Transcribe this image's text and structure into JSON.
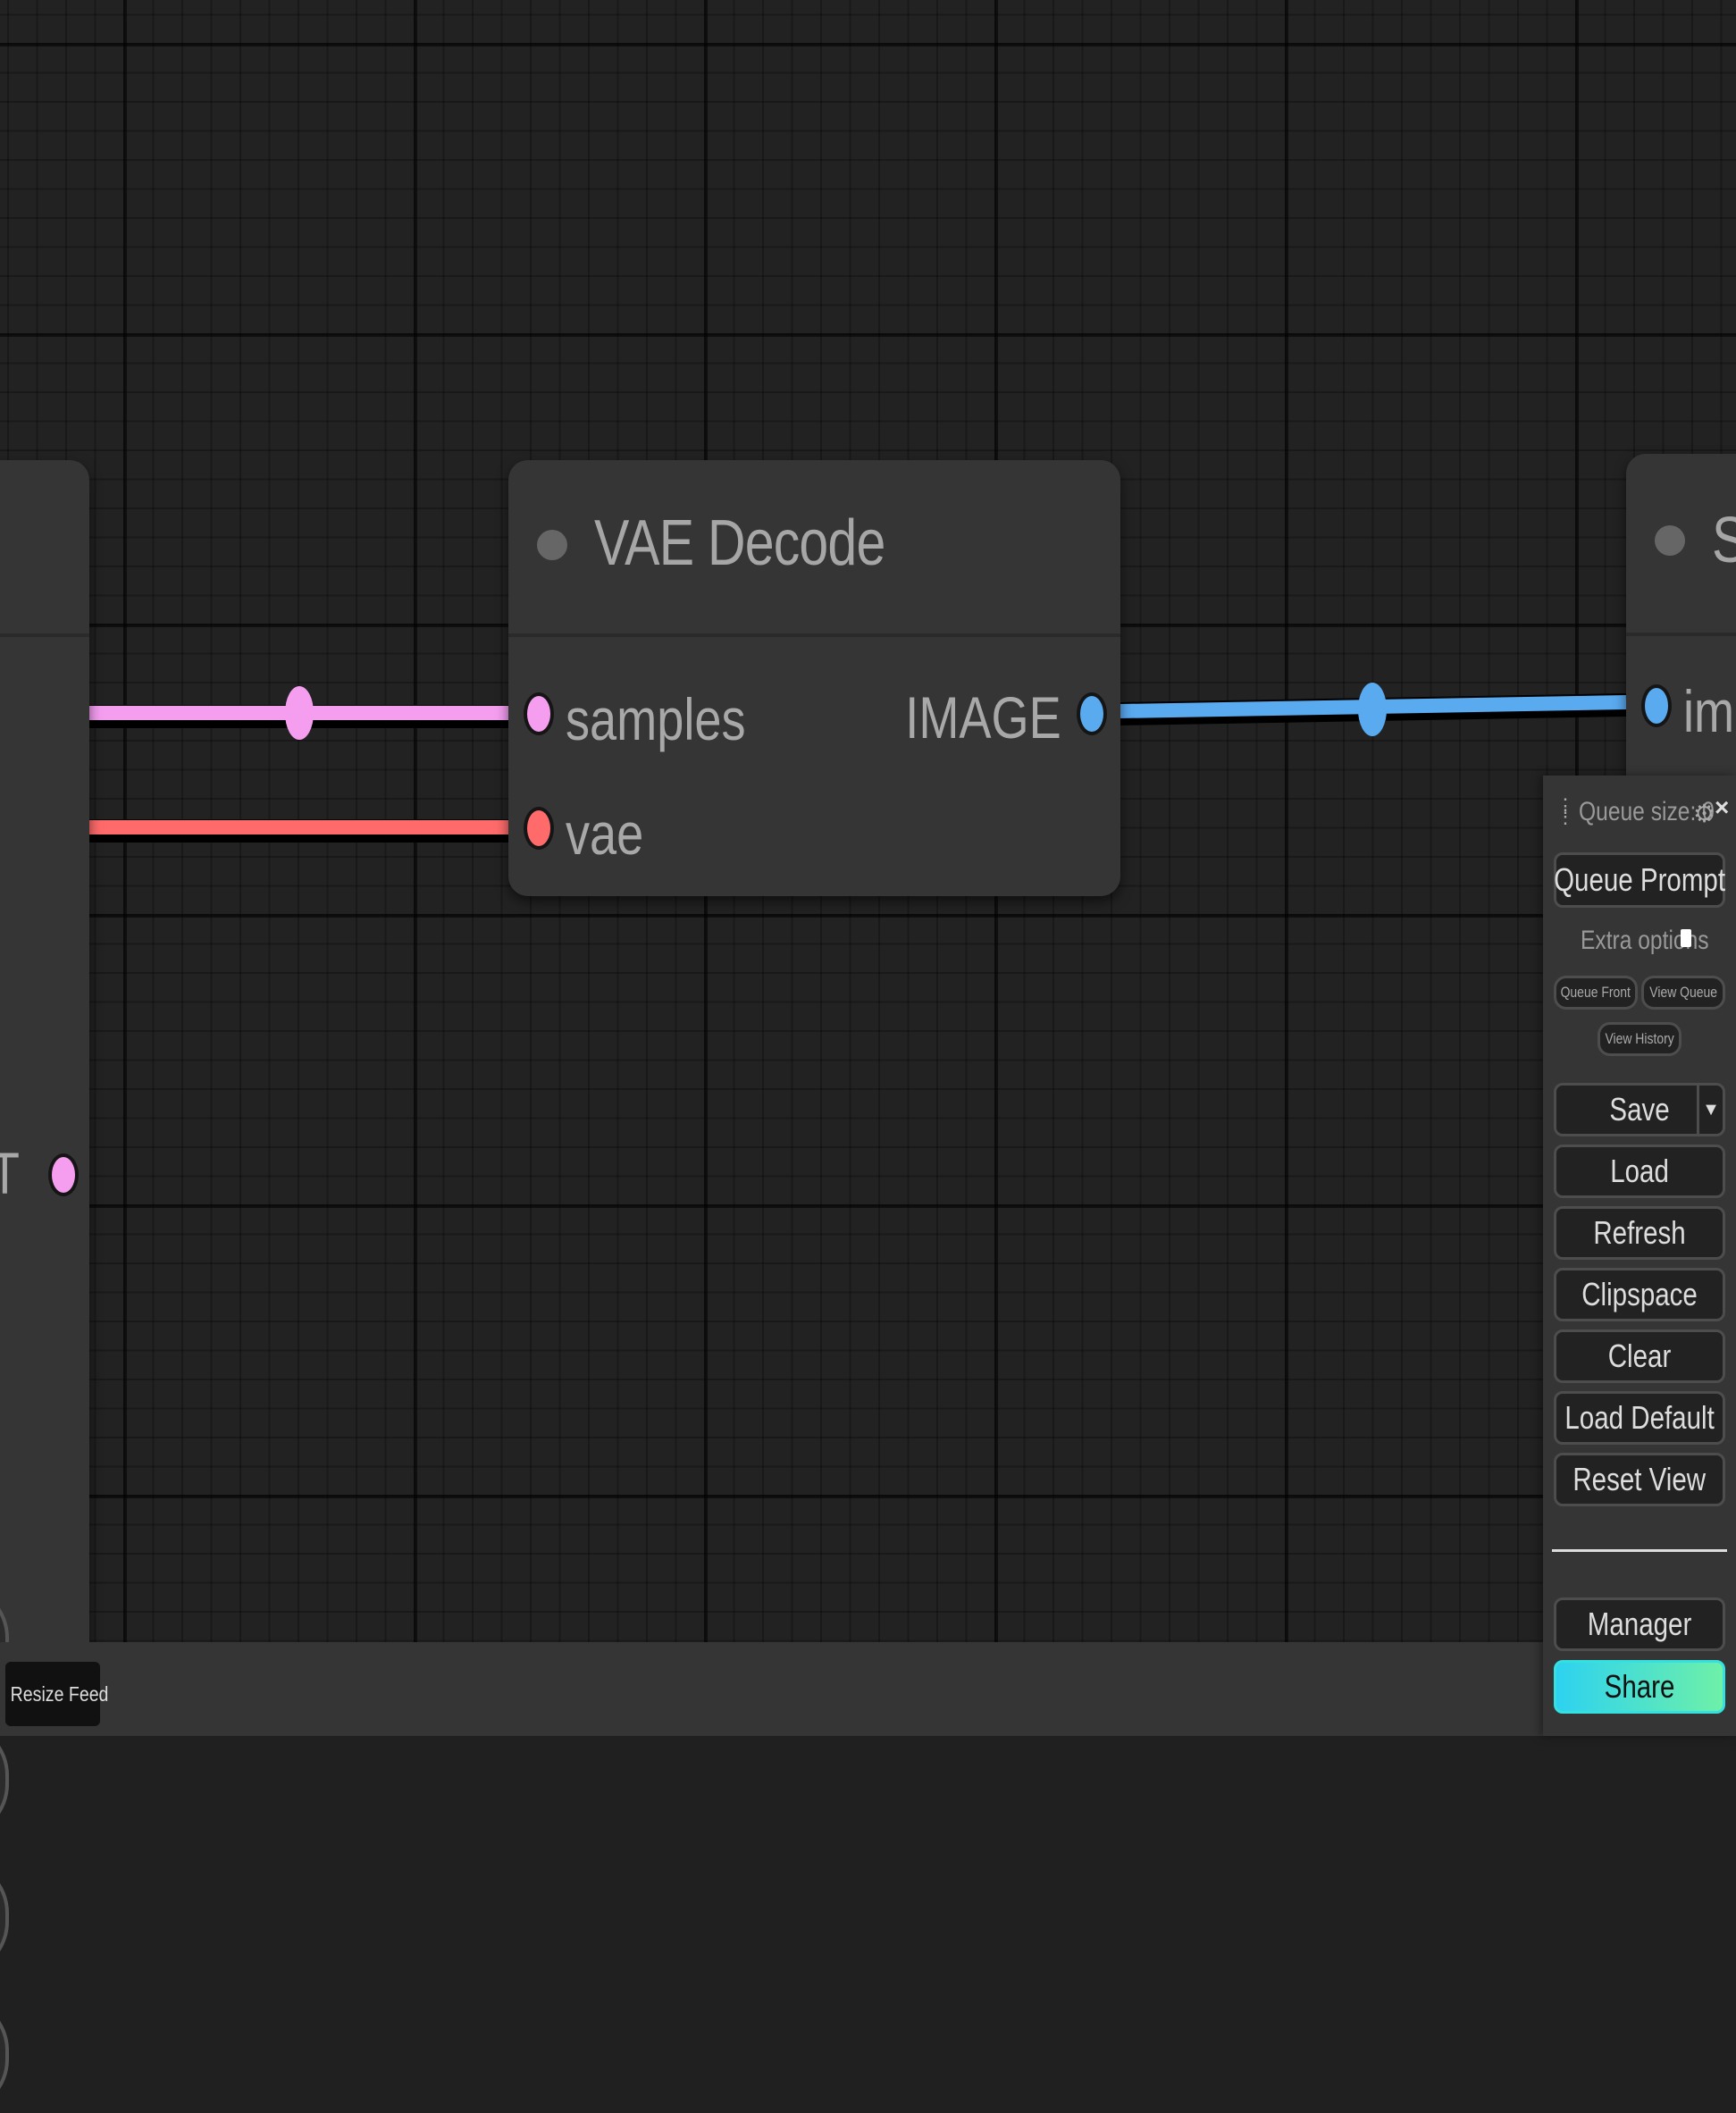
{
  "colors": {
    "latent_link": "#f59ef0",
    "vae_link": "#ff6b6b",
    "image_link": "#5aaaf0",
    "canvas_bg": "#222222",
    "node_bg": "#353535",
    "share_gradient_start": "#2dd2f0",
    "share_gradient_end": "#6ef0a8"
  },
  "left_node": {
    "output_label": "NT",
    "arrow_buttons": [
      "play-arrow-icon",
      "play-arrow-icon",
      "play-arrow-icon",
      "play-arrow-icon"
    ]
  },
  "vae_decode": {
    "title": "VAE Decode",
    "inputs": [
      {
        "label": "samples",
        "type": "LATENT"
      },
      {
        "label": "vae",
        "type": "VAE"
      }
    ],
    "outputs": [
      {
        "label": "IMAGE",
        "type": "IMAGE"
      }
    ]
  },
  "right_node": {
    "title": "S",
    "input_label": "ima"
  },
  "menu": {
    "queue_size": "Queue size: 0",
    "queue_prompt": "Queue Prompt",
    "extra_options": "Extra options",
    "queue_front": "Queue Front",
    "view_queue": "View Queue",
    "view_history": "View History",
    "save": "Save",
    "load": "Load",
    "refresh": "Refresh",
    "clipspace": "Clipspace",
    "clear": "Clear",
    "load_default": "Load Default",
    "reset_view": "Reset View",
    "manager": "Manager",
    "share": "Share"
  },
  "bottom_bar": {
    "resize_feed": "Resize Feed"
  }
}
